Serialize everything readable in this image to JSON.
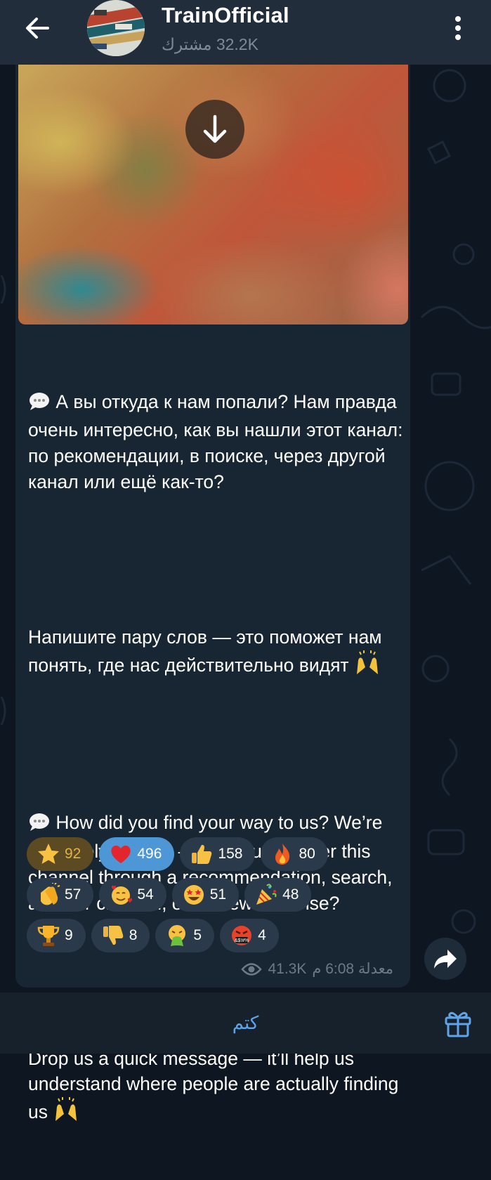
{
  "header": {
    "title": "TrainOfficial",
    "subtitle": "32.2K مشترك"
  },
  "message": {
    "paragraphs": [
      "А вы откуда к нам попали? Нам правда очень интересно, как вы нашли этот канал: по рекомендации, в поиске, через другой канал или ещё как-то?",
      "Напишите пару слов — это поможет нам понять, где нас действительно видят",
      "How did you find your way to us? We’re genuinely curious — did you discover this channel through a recommendation, search, another channel, or somewhere else?",
      "Drop us a quick message — it’ll help us understand where people are actually finding us"
    ],
    "views": "41.3K",
    "time": "معدلة 6:08 م"
  },
  "reactions": [
    {
      "icon": "star-icon",
      "count": "92"
    },
    {
      "icon": "red-heart-icon",
      "count": "496"
    },
    {
      "icon": "thumbs-up-icon",
      "count": "158"
    },
    {
      "icon": "fire-icon",
      "count": "80"
    },
    {
      "icon": "clapping-hands-icon",
      "count": "57"
    },
    {
      "icon": "smiling-face-with-hearts-icon",
      "count": "54"
    },
    {
      "icon": "star-struck-icon",
      "count": "51"
    },
    {
      "icon": "party-popper-icon",
      "count": "48"
    },
    {
      "icon": "trophy-icon",
      "count": "9"
    },
    {
      "icon": "thumbs-down-icon",
      "count": "8"
    },
    {
      "icon": "vomiting-face-icon",
      "count": "5"
    },
    {
      "icon": "cursing-face-icon",
      "count": "4"
    }
  ],
  "bottom_bar": {
    "mute_label": "كتم"
  },
  "colors": {
    "background": "#0e1621",
    "header": "#212d3b",
    "bubble": "#182533",
    "accent": "#5ea4e8",
    "active_reaction": "#4d97d6"
  }
}
